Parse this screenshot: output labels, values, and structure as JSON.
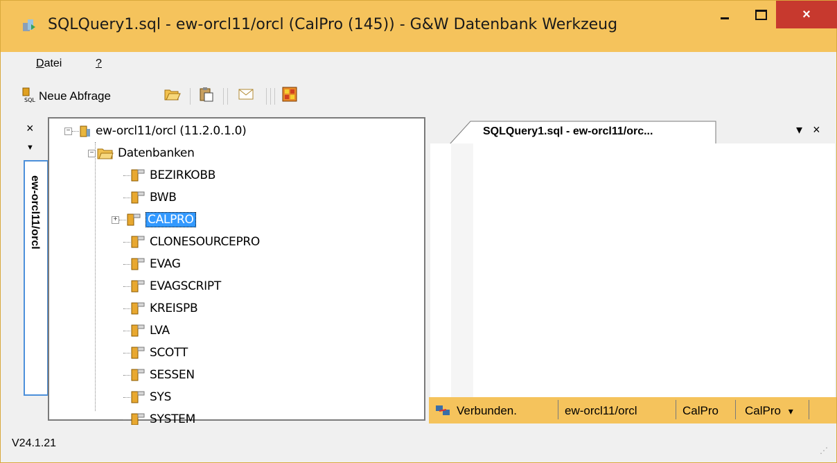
{
  "window": {
    "title": "SQLQuery1.sql - ew-orcl11/orcl (CalPro (145)) - G&W Datenbank Werkzeug",
    "close_glyph": "×"
  },
  "menu": {
    "items": [
      {
        "label": "Datei",
        "mnemonic": "D"
      },
      {
        "label": "?",
        "mnemonic": "?"
      }
    ]
  },
  "toolbar": {
    "new_query_label": "Neue Abfrage",
    "icons": [
      "sql-query-icon",
      "open-folder-icon",
      "clipboard-icon",
      "mail-icon",
      "grid-icon"
    ]
  },
  "side_panel": {
    "tab_label": "ew-orcl11/orcl",
    "close_glyph": "×",
    "dropdown_glyph": "▼"
  },
  "tree": {
    "root": "ew-orcl11/orcl (11.2.0.1.0)",
    "folder": "Datenbanken",
    "databases": [
      "BEZIRKOBB",
      "BWB",
      "CALPRO",
      "CLONESOURCEPRO",
      "EVAG",
      "EVAGSCRIPT",
      "KREISPB",
      "LVA",
      "SCOTT",
      "SESSEN",
      "SYS",
      "SYSTEM"
    ],
    "selected": "CALPRO"
  },
  "editor": {
    "tab_title": "SQLQuery1.sql - ew-orcl11/orc...",
    "dropdown_glyph": "▾",
    "close_glyph": "×"
  },
  "status": {
    "connection": "Verbunden.",
    "server": "ew-orcl11/orcl",
    "user": "CalPro",
    "schema": "CalPro",
    "schema_dropdown": "▾"
  },
  "footer": {
    "version": "V24.1.21"
  },
  "colors": {
    "title_bar": "#f5c35c",
    "close_button": "#c7392e",
    "selection": "#3399ff",
    "tab_border": "#4b8fda"
  }
}
